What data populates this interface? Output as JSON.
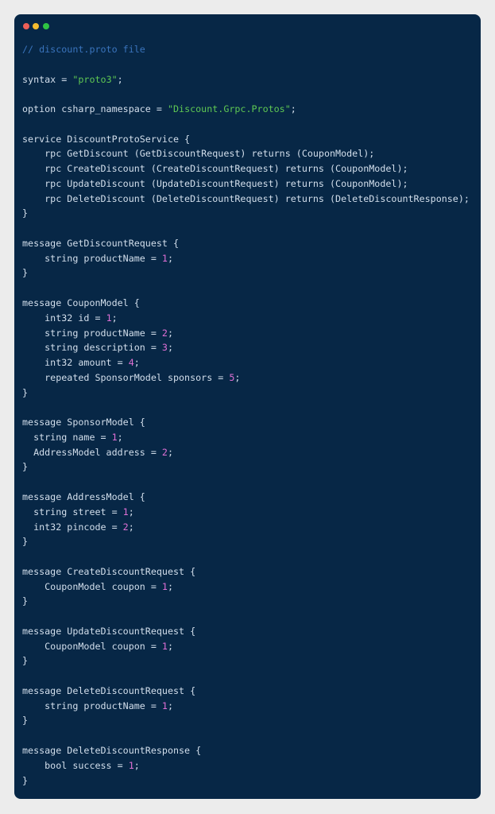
{
  "window": {
    "controls": [
      {
        "name": "close",
        "color": "#ee5f57"
      },
      {
        "name": "minimize",
        "color": "#f5bd2f"
      },
      {
        "name": "maximize",
        "color": "#2fc443"
      }
    ]
  },
  "colors": {
    "background": "#072746",
    "text": "#d3dfec",
    "comment": "#3a74bd",
    "string": "#5fc853",
    "number": "#e070d6"
  },
  "code": {
    "lines": [
      [
        {
          "c": "comment",
          "t": "// discount.proto file"
        }
      ],
      [],
      [
        {
          "c": "plain",
          "t": "syntax = "
        },
        {
          "c": "string",
          "t": "\"proto3\""
        },
        {
          "c": "plain",
          "t": ";"
        }
      ],
      [],
      [
        {
          "c": "plain",
          "t": "option csharp_namespace = "
        },
        {
          "c": "string",
          "t": "\"Discount.Grpc.Protos\""
        },
        {
          "c": "plain",
          "t": ";"
        }
      ],
      [],
      [
        {
          "c": "plain",
          "t": "service DiscountProtoService {"
        }
      ],
      [
        {
          "c": "plain",
          "t": "    rpc GetDiscount (GetDiscountRequest) returns (CouponModel);"
        }
      ],
      [
        {
          "c": "plain",
          "t": "    rpc CreateDiscount (CreateDiscountRequest) returns (CouponModel);"
        }
      ],
      [
        {
          "c": "plain",
          "t": "    rpc UpdateDiscount (UpdateDiscountRequest) returns (CouponModel);"
        }
      ],
      [
        {
          "c": "plain",
          "t": "    rpc DeleteDiscount (DeleteDiscountRequest) returns (DeleteDiscountResponse);"
        }
      ],
      [
        {
          "c": "plain",
          "t": "}"
        }
      ],
      [],
      [
        {
          "c": "plain",
          "t": "message GetDiscountRequest {"
        }
      ],
      [
        {
          "c": "plain",
          "t": "    string productName = "
        },
        {
          "c": "number",
          "t": "1"
        },
        {
          "c": "plain",
          "t": ";"
        }
      ],
      [
        {
          "c": "plain",
          "t": "}"
        }
      ],
      [],
      [
        {
          "c": "plain",
          "t": "message CouponModel {"
        }
      ],
      [
        {
          "c": "plain",
          "t": "    int32 id = "
        },
        {
          "c": "number",
          "t": "1"
        },
        {
          "c": "plain",
          "t": ";"
        }
      ],
      [
        {
          "c": "plain",
          "t": "    string productName = "
        },
        {
          "c": "number",
          "t": "2"
        },
        {
          "c": "plain",
          "t": ";"
        }
      ],
      [
        {
          "c": "plain",
          "t": "    string description = "
        },
        {
          "c": "number",
          "t": "3"
        },
        {
          "c": "plain",
          "t": ";"
        }
      ],
      [
        {
          "c": "plain",
          "t": "    int32 amount = "
        },
        {
          "c": "number",
          "t": "4"
        },
        {
          "c": "plain",
          "t": ";"
        }
      ],
      [
        {
          "c": "plain",
          "t": "    repeated SponsorModel sponsors = "
        },
        {
          "c": "number",
          "t": "5"
        },
        {
          "c": "plain",
          "t": ";"
        }
      ],
      [
        {
          "c": "plain",
          "t": "}"
        }
      ],
      [],
      [
        {
          "c": "plain",
          "t": "message SponsorModel {"
        }
      ],
      [
        {
          "c": "plain",
          "t": "  string name = "
        },
        {
          "c": "number",
          "t": "1"
        },
        {
          "c": "plain",
          "t": ";"
        }
      ],
      [
        {
          "c": "plain",
          "t": "  AddressModel address = "
        },
        {
          "c": "number",
          "t": "2"
        },
        {
          "c": "plain",
          "t": ";"
        }
      ],
      [
        {
          "c": "plain",
          "t": "}"
        }
      ],
      [],
      [
        {
          "c": "plain",
          "t": "message AddressModel {"
        }
      ],
      [
        {
          "c": "plain",
          "t": "  string street = "
        },
        {
          "c": "number",
          "t": "1"
        },
        {
          "c": "plain",
          "t": ";"
        }
      ],
      [
        {
          "c": "plain",
          "t": "  int32 pincode = "
        },
        {
          "c": "number",
          "t": "2"
        },
        {
          "c": "plain",
          "t": ";"
        }
      ],
      [
        {
          "c": "plain",
          "t": "}"
        }
      ],
      [],
      [
        {
          "c": "plain",
          "t": "message CreateDiscountRequest {"
        }
      ],
      [
        {
          "c": "plain",
          "t": "    CouponModel coupon = "
        },
        {
          "c": "number",
          "t": "1"
        },
        {
          "c": "plain",
          "t": ";"
        }
      ],
      [
        {
          "c": "plain",
          "t": "}"
        }
      ],
      [],
      [
        {
          "c": "plain",
          "t": "message UpdateDiscountRequest {"
        }
      ],
      [
        {
          "c": "plain",
          "t": "    CouponModel coupon = "
        },
        {
          "c": "number",
          "t": "1"
        },
        {
          "c": "plain",
          "t": ";"
        }
      ],
      [
        {
          "c": "plain",
          "t": "}"
        }
      ],
      [],
      [
        {
          "c": "plain",
          "t": "message DeleteDiscountRequest {"
        }
      ],
      [
        {
          "c": "plain",
          "t": "    string productName = "
        },
        {
          "c": "number",
          "t": "1"
        },
        {
          "c": "plain",
          "t": ";"
        }
      ],
      [
        {
          "c": "plain",
          "t": "}"
        }
      ],
      [],
      [
        {
          "c": "plain",
          "t": "message DeleteDiscountResponse {"
        }
      ],
      [
        {
          "c": "plain",
          "t": "    bool success = "
        },
        {
          "c": "number",
          "t": "1"
        },
        {
          "c": "plain",
          "t": ";"
        }
      ],
      [
        {
          "c": "plain",
          "t": "}"
        }
      ]
    ]
  }
}
